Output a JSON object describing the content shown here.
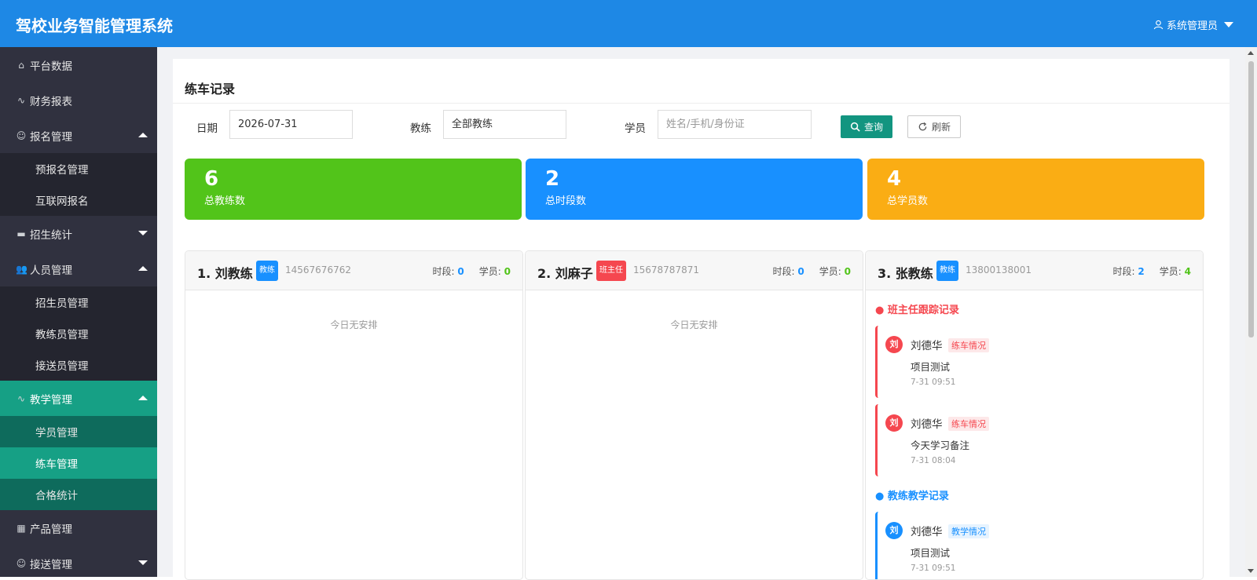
{
  "app": {
    "title": "驾校业务智能管理系统",
    "user": "系统管理员",
    "user_icon": "user-icon"
  },
  "sidebar": {
    "items": [
      {
        "label": "平台数据",
        "icon": "home-icon"
      },
      {
        "label": "财务报表",
        "icon": "pulse-icon"
      },
      {
        "label": "报名管理",
        "icon": "user-icon",
        "expanded": true,
        "children": [
          "预报名管理",
          "互联网报名"
        ]
      },
      {
        "label": "招生统计",
        "icon": "chat-icon",
        "expanded": false
      },
      {
        "label": "人员管理",
        "icon": "users-icon",
        "expanded": true,
        "children": [
          "招生员管理",
          "教练员管理",
          "接送员管理"
        ]
      },
      {
        "label": "教学管理",
        "icon": "pulse-icon",
        "expanded": true,
        "active": true,
        "children": [
          "学员管理",
          "练车管理",
          "合格统计"
        ],
        "active_child": "练车管理"
      },
      {
        "label": "产品管理",
        "icon": "grid-icon"
      },
      {
        "label": "接送管理",
        "icon": "user-icon",
        "expanded": false
      }
    ]
  },
  "page": {
    "title": "练车记录",
    "filters": {
      "date_label": "日期",
      "date_value": "2026-07-31",
      "coach_label": "教练",
      "coach_value": "全部教练",
      "student_label": "学员",
      "student_placeholder": "姓名/手机/身份证",
      "query_label": "查询",
      "refresh_label": "刷新"
    },
    "stats": [
      {
        "value": "6",
        "label": "总教练数",
        "color": "#52c41a"
      },
      {
        "value": "2",
        "label": "总时段数",
        "color": "#1890ff"
      },
      {
        "value": "4",
        "label": "总学员数",
        "color": "#faad14"
      }
    ],
    "cards": [
      {
        "name": "1. 刘教练",
        "badge": "教练",
        "badge_color": "#1890ff",
        "phone": "14567676762",
        "slots_label": "时段:",
        "slots": "0",
        "students_label": "学员:",
        "students": "0",
        "empty": "今日无安排"
      },
      {
        "name": "2. 刘麻子",
        "badge": "班主任",
        "badge_color": "#f5474f",
        "phone": "15678787871",
        "slots_label": "时段:",
        "slots": "0",
        "students_label": "学员:",
        "students": "0",
        "empty": "今日无安排"
      },
      {
        "name": "3. 张教练",
        "badge": "教练",
        "badge_color": "#1890ff",
        "phone": "13800138001",
        "slots_label": "时段:",
        "slots": "2",
        "students_label": "学员:",
        "students": "4",
        "sections": [
          {
            "title": "● 班主任跟踪记录",
            "color": "#f5474f",
            "records": [
              {
                "avatar": "刘",
                "name": "刘德华",
                "tag": "练车情况",
                "text": "项目测试",
                "time": "7-31 09:51"
              },
              {
                "avatar": "刘",
                "name": "刘德华",
                "tag": "练车情况",
                "text": "今天学习备注",
                "time": "7-31 08:04"
              }
            ]
          },
          {
            "title": "● 教练教学记录",
            "color": "#1890ff",
            "records": [
              {
                "avatar": "刘",
                "name": "刘德华",
                "tag": "教学情况",
                "text": "项目测试",
                "time": "7-31 09:51"
              }
            ]
          }
        ]
      }
    ]
  }
}
